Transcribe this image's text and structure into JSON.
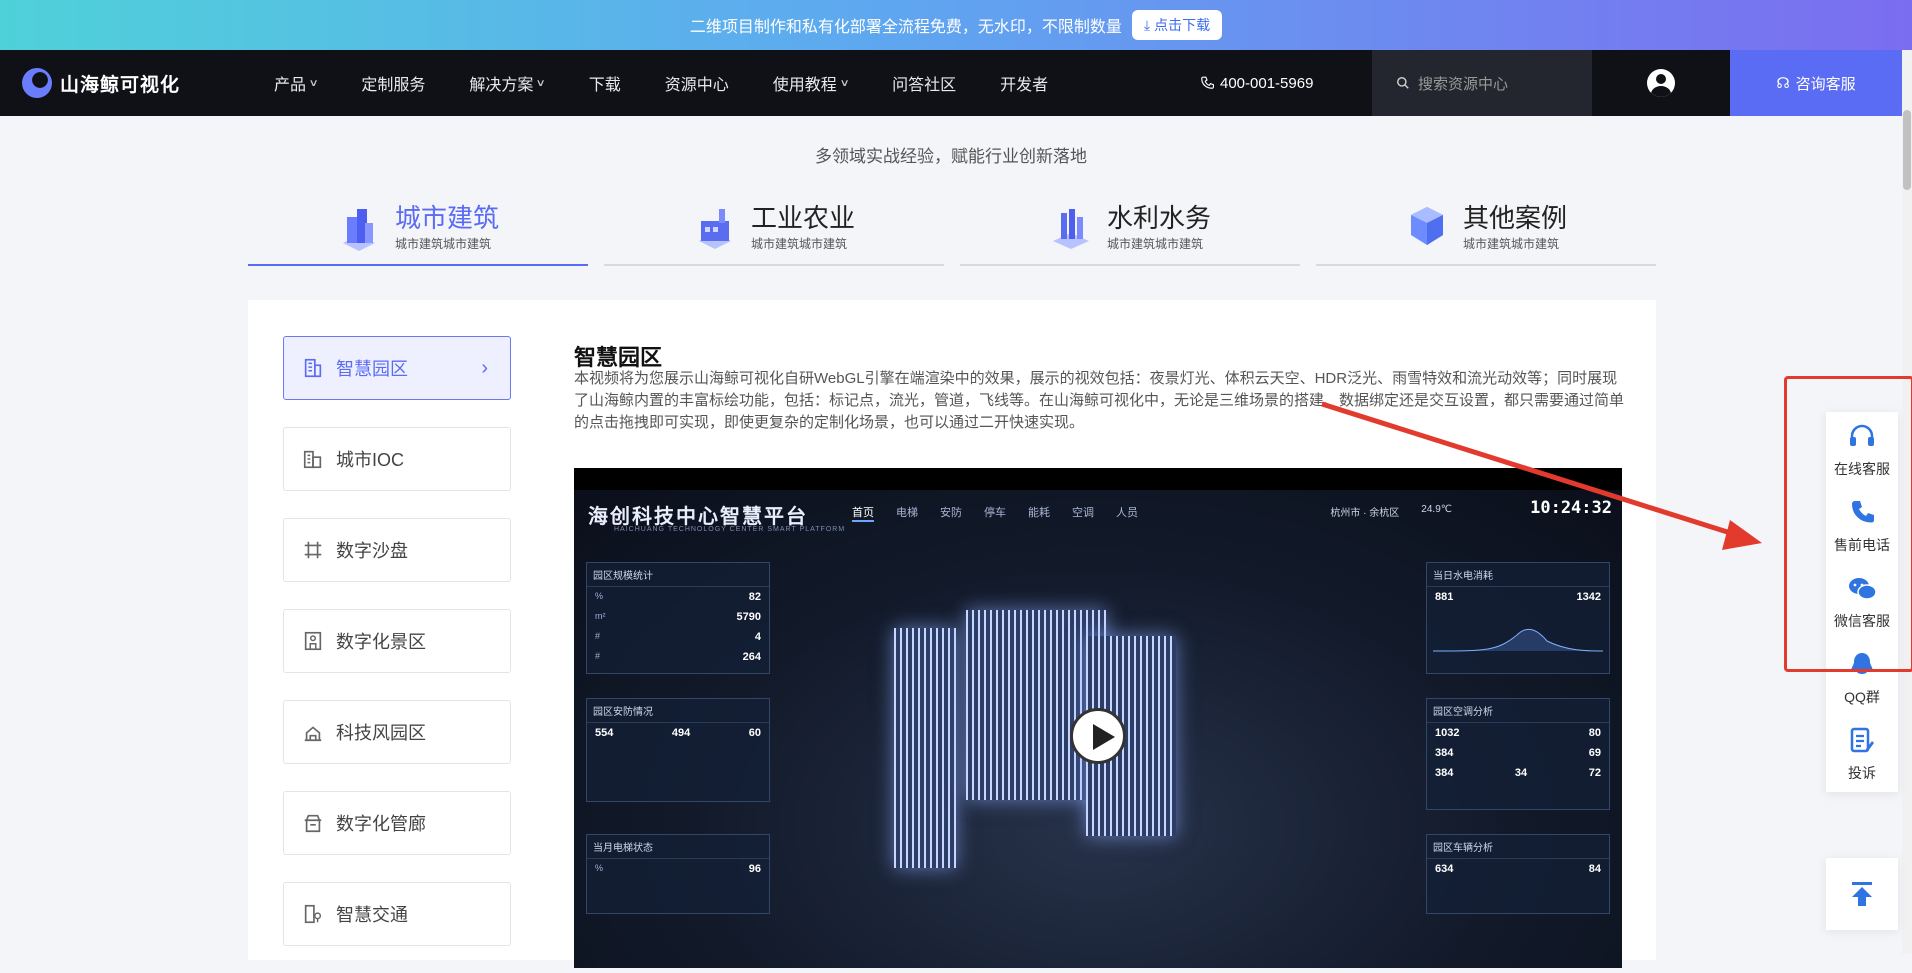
{
  "promo": {
    "text": "二维项目制作和私有化部署全流程免费，无水印，不限制数量",
    "button": "点击下载"
  },
  "nav": {
    "logo": "山海鲸可视化",
    "menu": [
      {
        "label": "产品",
        "dropdown": true
      },
      {
        "label": "定制服务",
        "dropdown": false
      },
      {
        "label": "解决方案",
        "dropdown": true
      },
      {
        "label": "下载",
        "dropdown": false
      },
      {
        "label": "资源中心",
        "dropdown": false
      },
      {
        "label": "使用教程",
        "dropdown": true
      },
      {
        "label": "问答社区",
        "dropdown": false
      },
      {
        "label": "开发者",
        "dropdown": false
      }
    ],
    "phone": "400-001-5969",
    "search_placeholder": "搜索资源中心",
    "consult": "咨询客服"
  },
  "section": {
    "subtitle": "多领域实战经验，赋能行业创新落地"
  },
  "tabs": [
    {
      "title": "城市建筑",
      "sub": "城市建筑城市建筑",
      "active": true,
      "icon": "city-building-icon"
    },
    {
      "title": "工业农业",
      "sub": "城市建筑城市建筑",
      "active": false,
      "icon": "factory-icon"
    },
    {
      "title": "水利水务",
      "sub": "城市建筑城市建筑",
      "active": false,
      "icon": "water-icon"
    },
    {
      "title": "其他案例",
      "sub": "城市建筑城市建筑",
      "active": false,
      "icon": "cubes-icon"
    }
  ],
  "sidebar": {
    "items": [
      {
        "label": "智慧园区",
        "active": true,
        "icon": "office-building-icon"
      },
      {
        "label": "城市IOC",
        "active": false,
        "icon": "city-icon"
      },
      {
        "label": "数字沙盘",
        "active": false,
        "icon": "grid-icon"
      },
      {
        "label": "数字化景区",
        "active": false,
        "icon": "gate-icon"
      },
      {
        "label": "科技风园区",
        "active": false,
        "icon": "tech-park-icon"
      },
      {
        "label": "数字化管廊",
        "active": false,
        "icon": "pipe-icon"
      },
      {
        "label": "智慧交通",
        "active": false,
        "icon": "traffic-icon"
      }
    ]
  },
  "content": {
    "title": "智慧园区",
    "description": "本视频将为您展示山海鲸可视化自研WebGL引擎在端渲染中的效果，展示的视效包括：夜景灯光、体积云天空、HDR泛光、雨雪特效和流光动效等；同时展现了山海鲸内置的丰富标绘功能，包括：标记点，流光，管道，飞线等。在山海鲸可视化中，无论是三维场景的搭建、数据绑定还是交互设置，都只需要通过简单的点击拖拽即可实现，即使更复杂的定制化场景，也可以通过二开快速实现。"
  },
  "video": {
    "platform_title": "海创科技中心智慧平台",
    "platform_sub": "HAICHUANG TECHNOLOGY CENTER SMART PLATFORM",
    "tabs": [
      "首页",
      "电梯",
      "安防",
      "停车",
      "能耗",
      "空调",
      "人员"
    ],
    "location": "杭州市 · 余杭区",
    "temperature": "24.9℃",
    "time": "10:24:32",
    "panels": {
      "park_stats": {
        "title": "园区规模统计",
        "rate": "82",
        "area": "5790",
        "buildings": "4",
        "offices": "264"
      },
      "security": {
        "title": "园区安防情况",
        "monitors": "554",
        "normal": "494",
        "fault": "60"
      },
      "power": {
        "title": "当日水电消耗",
        "water": "881",
        "electric": "1342"
      },
      "aircon": {
        "title": "园区空调分析",
        "total": "1032",
        "on": "384",
        "comfort": "69",
        "off": "384",
        "fault": "34",
        "equip": "80",
        "energy": "72"
      },
      "elevator": {
        "title": "当月电梯状态",
        "value": "96"
      },
      "parking": {
        "title": "园区车辆分析",
        "total": "634",
        "rate": "84"
      }
    }
  },
  "float_bar": {
    "items": [
      {
        "label": "在线客服",
        "icon": "headset-icon"
      },
      {
        "label": "售前电话",
        "icon": "phone-icon"
      },
      {
        "label": "微信客服",
        "icon": "wechat-icon"
      },
      {
        "label": "QQ群",
        "icon": "qq-icon"
      },
      {
        "label": "投诉",
        "icon": "complaint-icon"
      }
    ],
    "top_icon": "back-to-top-icon"
  },
  "annotation": {
    "color": "#e23b2e"
  }
}
